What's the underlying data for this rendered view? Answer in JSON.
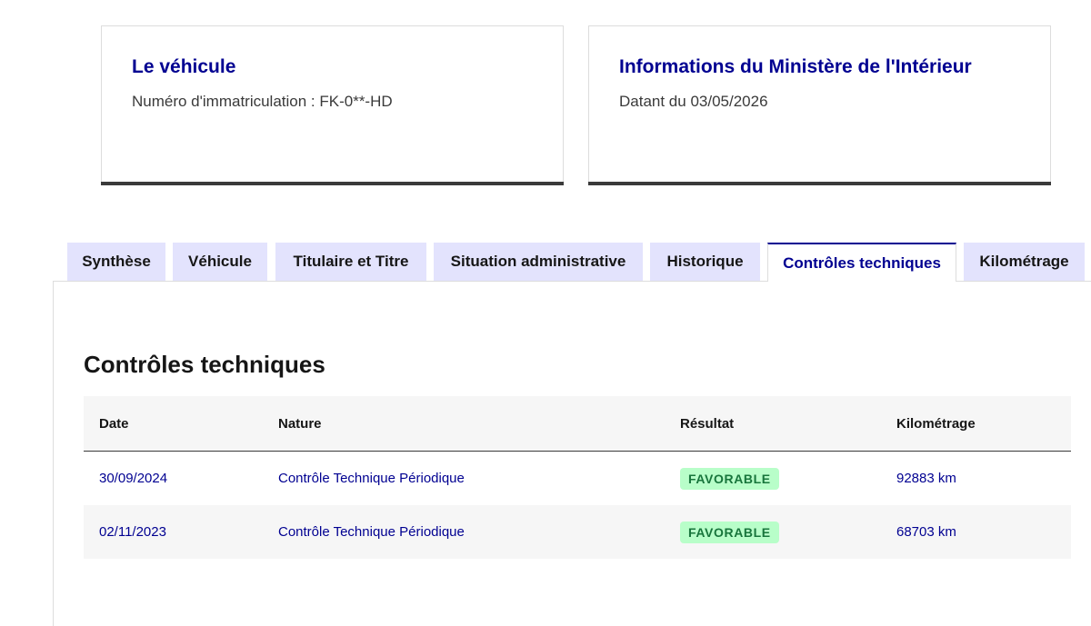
{
  "cards": {
    "vehicle": {
      "title": "Le véhicule",
      "description": "Numéro d'immatriculation : FK-0**-HD"
    },
    "ministry": {
      "title": "Informations du Ministère de l'Intérieur",
      "description": "Datant du 03/05/2026"
    }
  },
  "tabs": [
    {
      "label": "Synthèse",
      "active": false
    },
    {
      "label": "Véhicule",
      "active": false
    },
    {
      "label": "Titulaire et Titre",
      "active": false
    },
    {
      "label": "Situation administrative",
      "active": false
    },
    {
      "label": "Historique",
      "active": false
    },
    {
      "label": "Contrôles techniques",
      "active": true
    },
    {
      "label": "Kilométrage",
      "active": false
    }
  ],
  "section": {
    "title": "Contrôles techniques"
  },
  "table": {
    "headers": [
      "Date",
      "Nature",
      "Résultat",
      "Kilométrage"
    ],
    "rows": [
      {
        "date": "30/09/2024",
        "nature": "Contrôle Technique Périodique",
        "result": "FAVORABLE",
        "mileage": "92883 km"
      },
      {
        "date": "02/11/2023",
        "nature": "Contrôle Technique Périodique",
        "result": "FAVORABLE",
        "mileage": "68703 km"
      }
    ]
  },
  "colors": {
    "primary": "#000091",
    "tab_bg": "#e3e3fd",
    "badge_bg": "#b8fec9",
    "badge_text": "#18753c"
  }
}
